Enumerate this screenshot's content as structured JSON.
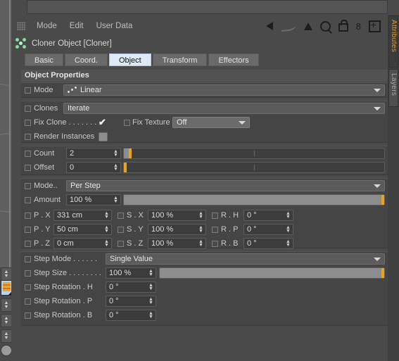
{
  "menubar": {
    "items": [
      "Mode",
      "Edit",
      "User Data"
    ],
    "icons": [
      "back-arrow-icon",
      "swoosh-icon",
      "up-arrow-icon",
      "search-icon",
      "lock-icon",
      "layers-icon",
      "add-icon"
    ]
  },
  "object": {
    "title": "Cloner Object [Cloner]",
    "icon": "cloner-object-icon"
  },
  "tabs": [
    {
      "label": "Basic",
      "active": false
    },
    {
      "label": "Coord.",
      "active": false
    },
    {
      "label": "Object",
      "active": true
    },
    {
      "label": "Transform",
      "active": false
    },
    {
      "label": "Effectors",
      "active": false
    }
  ],
  "section": {
    "title": "Object Properties"
  },
  "properties": {
    "mode": {
      "label": "Mode",
      "value": "Linear"
    },
    "clones": {
      "label": "Clones",
      "value": "Iterate"
    },
    "fix_clone": {
      "label": "Fix Clone",
      "checked": true
    },
    "fix_texture": {
      "label": "Fix Texture",
      "value": "Off"
    },
    "render_instances": {
      "label": "Render Instances",
      "checked": false
    },
    "count": {
      "label": "Count",
      "value": "2",
      "slider_percent": 2
    },
    "offset": {
      "label": "Offset",
      "value": "0",
      "slider_percent": 0
    },
    "step_mode_2": {
      "label": "Mode..",
      "value": "Per Step"
    },
    "amount": {
      "label": "Amount",
      "value": "100 %",
      "slider_percent": 100
    }
  },
  "transform": {
    "rows": [
      {
        "p_label": "P . X",
        "p_value": "331 cm",
        "s_label": "S . X",
        "s_value": "100 %",
        "r_label": "R . H",
        "r_value": "0 °"
      },
      {
        "p_label": "P . Y",
        "p_value": "50 cm",
        "s_label": "S . Y",
        "s_value": "100 %",
        "r_label": "R . P",
        "r_value": "0 °"
      },
      {
        "p_label": "P . Z",
        "p_value": "0 cm",
        "s_label": "S . Z",
        "s_value": "100 %",
        "r_label": "R . B",
        "r_value": "0 °"
      }
    ]
  },
  "step": {
    "step_mode": {
      "label": "Step Mode . . . . . .",
      "value": "Single Value"
    },
    "step_size": {
      "label": "Step Size . . . . . . . .",
      "value": "100 %",
      "slider_percent": 100
    },
    "rotation_h": {
      "label": "Step Rotation . H",
      "value": "0 °"
    },
    "rotation_p": {
      "label": "Step Rotation . P",
      "value": "0 °"
    },
    "rotation_b": {
      "label": "Step Rotation . B",
      "value": "0 °"
    }
  },
  "labels_dotted": {
    "fix_clone": "Fix Clone . . . . . . . ."
  },
  "vtabs": [
    {
      "label": "Attributes",
      "active": true
    },
    {
      "label": "Layers",
      "active": false
    }
  ],
  "colors": {
    "accent_orange": "#f0a020",
    "active_tab": "#dce9f7",
    "panel_bg": "#4a4a4a",
    "group_bg": "#454545"
  }
}
